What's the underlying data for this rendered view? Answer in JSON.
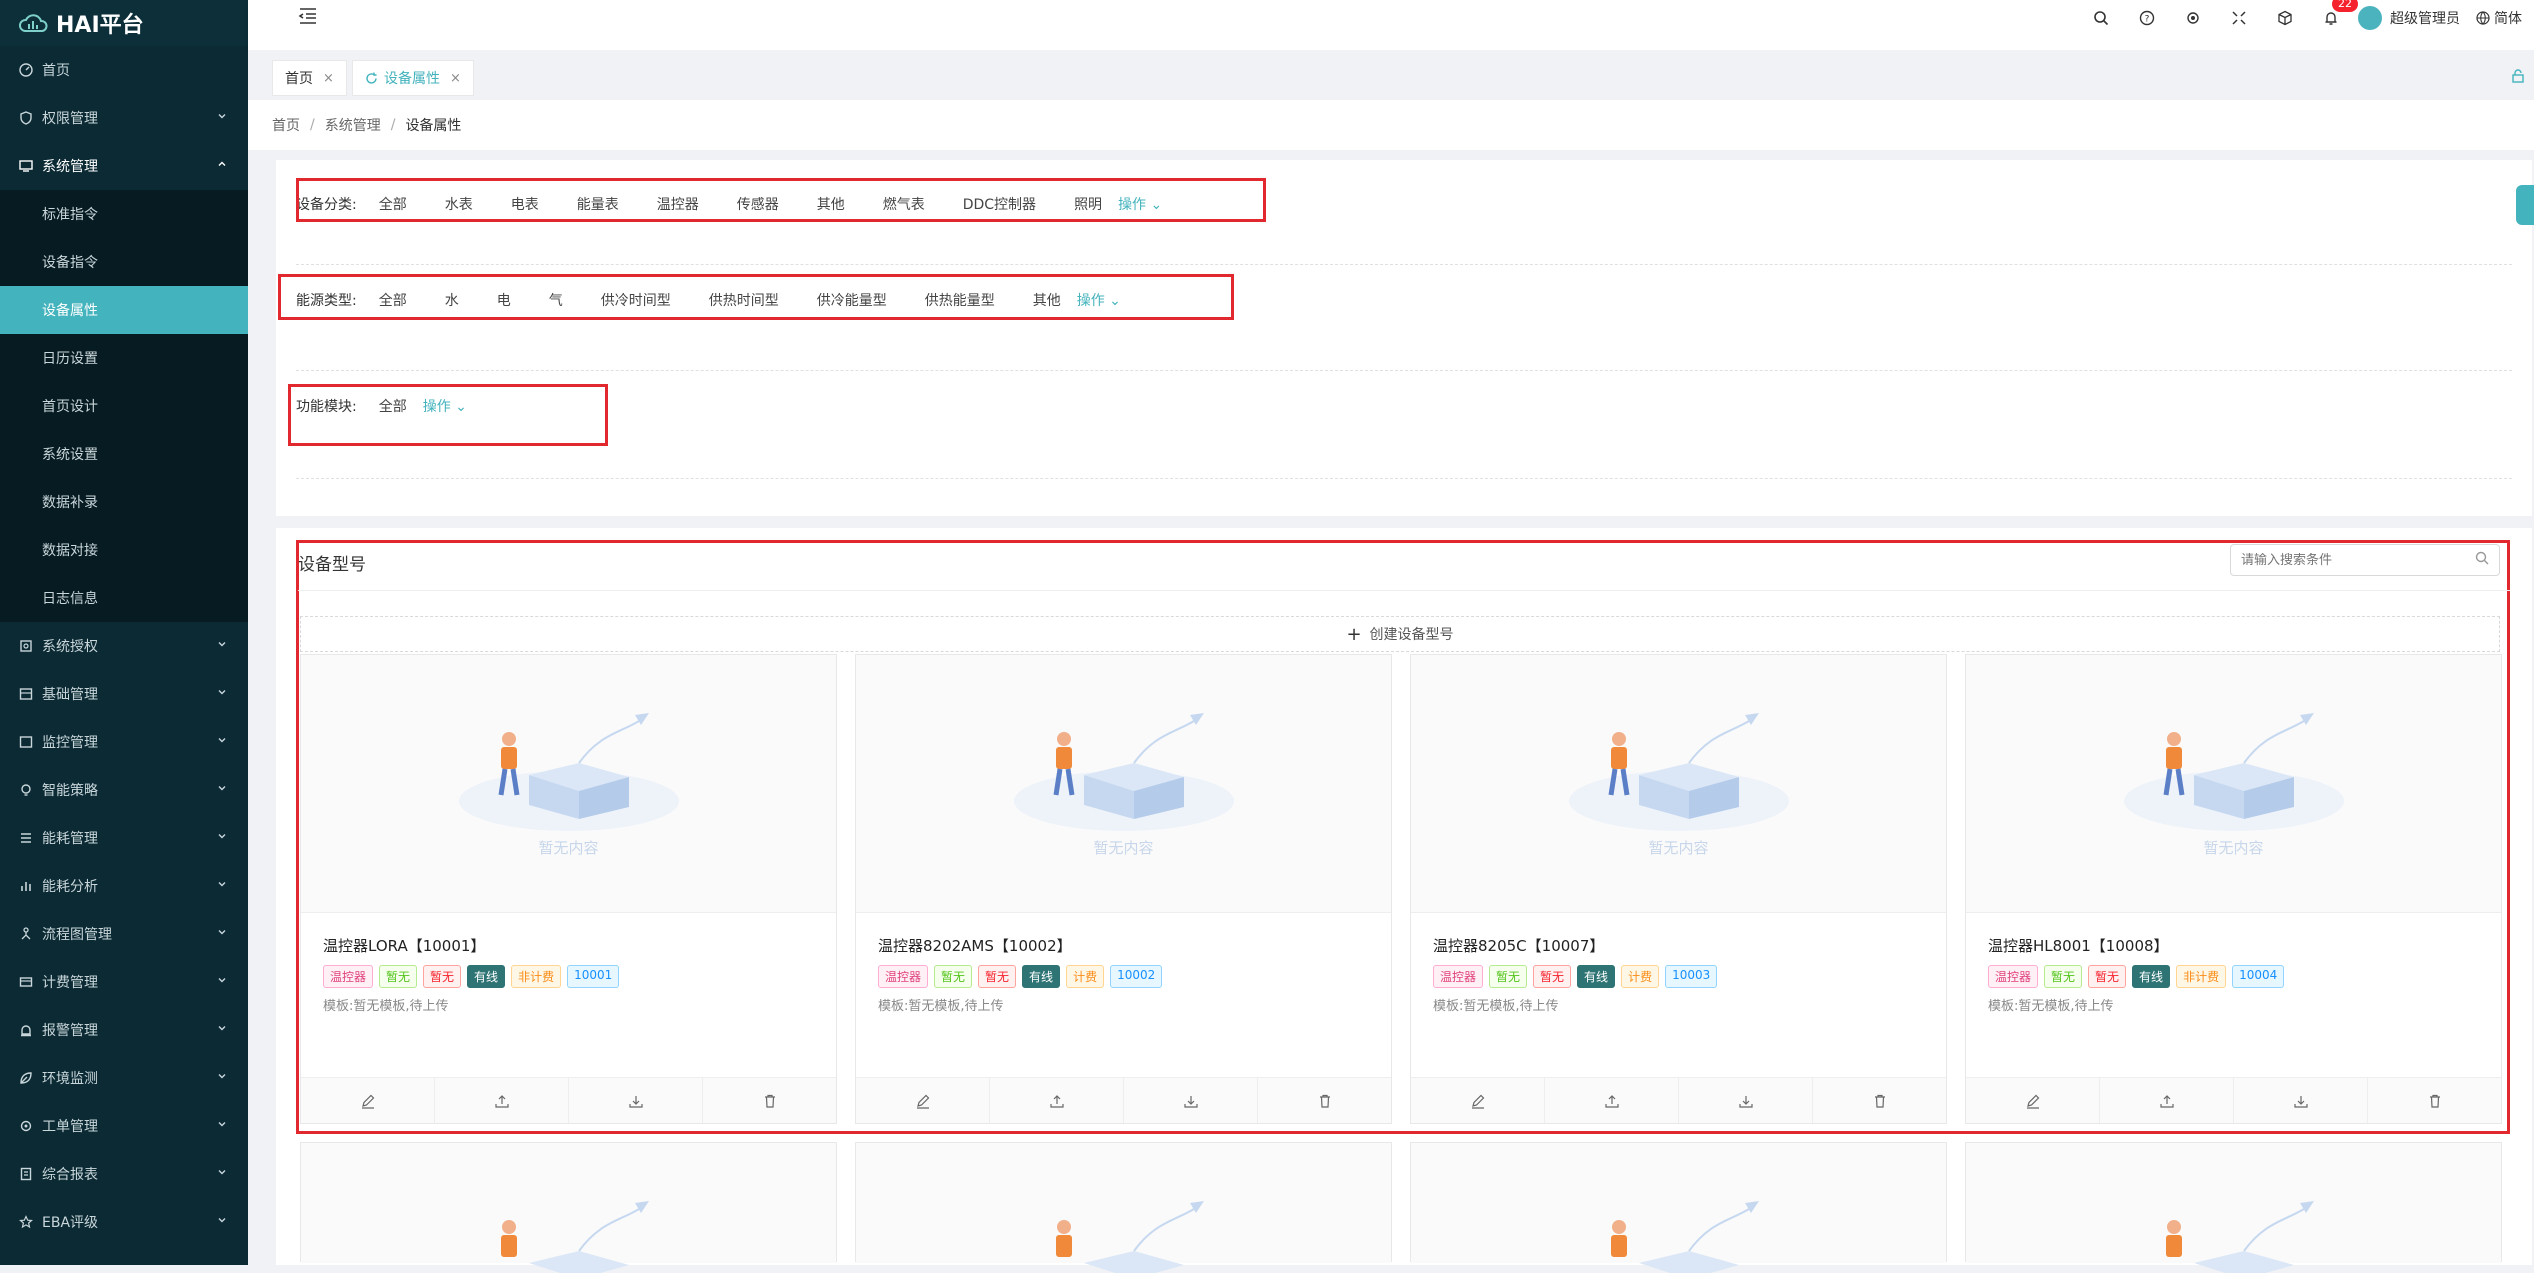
{
  "app": {
    "title": "HAI平台"
  },
  "sidebar": {
    "items": [
      {
        "label": "首页"
      },
      {
        "label": "权限管理"
      },
      {
        "label": "系统管理"
      },
      {
        "label": "系统授权"
      },
      {
        "label": "基础管理"
      },
      {
        "label": "监控管理"
      },
      {
        "label": "智能策略"
      },
      {
        "label": "能耗管理"
      },
      {
        "label": "能耗分析"
      },
      {
        "label": "流程图管理"
      },
      {
        "label": "计费管理"
      },
      {
        "label": "报警管理"
      },
      {
        "label": "环境监测"
      },
      {
        "label": "工单管理"
      },
      {
        "label": "综合报表"
      },
      {
        "label": "EBA评级"
      }
    ],
    "sub_items": [
      {
        "label": "标准指令"
      },
      {
        "label": "设备指令"
      },
      {
        "label": "设备属性"
      },
      {
        "label": "日历设置"
      },
      {
        "label": "首页设计"
      },
      {
        "label": "系统设置"
      },
      {
        "label": "数据补录"
      },
      {
        "label": "数据对接"
      },
      {
        "label": "日志信息"
      }
    ]
  },
  "header": {
    "notification_count": "22",
    "user": "超级管理员",
    "lang": "简体"
  },
  "tabs": [
    {
      "label": "首页"
    },
    {
      "label": "设备属性"
    }
  ],
  "breadcrumb": [
    "首页",
    "系统管理",
    "设备属性"
  ],
  "filters": {
    "category": {
      "label": "设备分类:",
      "items": [
        "全部",
        "水表",
        "电表",
        "能量表",
        "温控器",
        "传感器",
        "其他",
        "燃气表",
        "DDC控制器",
        "照明"
      ],
      "op": "操作"
    },
    "energy": {
      "label": "能源类型:",
      "items": [
        "全部",
        "水",
        "电",
        "气",
        "供冷时间型",
        "供热时间型",
        "供冷能量型",
        "供热能量型",
        "其他"
      ],
      "op": "操作"
    },
    "module": {
      "label": "功能模块:",
      "items": [
        "全部"
      ],
      "op": "操作"
    }
  },
  "models": {
    "title": "设备型号",
    "search_placeholder": "请输入搜索条件",
    "create_label": "创建设备型号",
    "empty_text": "暂无内容",
    "cards": [
      {
        "title": "温控器LORA【10001】",
        "tags": [
          "温控器",
          "暂无",
          "暂无",
          "有线",
          "非计费",
          "10001"
        ],
        "meta": "模板:暂无模板,待上传"
      },
      {
        "title": "温控器8202AMS【10002】",
        "tags": [
          "温控器",
          "暂无",
          "暂无",
          "有线",
          "计费",
          "10002"
        ],
        "meta": "模板:暂无模板,待上传"
      },
      {
        "title": "温控器8205C【10007】",
        "tags": [
          "温控器",
          "暂无",
          "暂无",
          "有线",
          "计费",
          "10003"
        ],
        "meta": "模板:暂无模板,待上传"
      },
      {
        "title": "温控器HL8001【10008】",
        "tags": [
          "温控器",
          "暂无",
          "暂无",
          "有线",
          "非计费",
          "10004"
        ],
        "meta": "模板:暂无模板,待上传"
      }
    ]
  },
  "colors": {
    "accent": "#43b3bd",
    "sidebar_bg": "#0b2a34",
    "highlight_box": "#e0282e"
  }
}
